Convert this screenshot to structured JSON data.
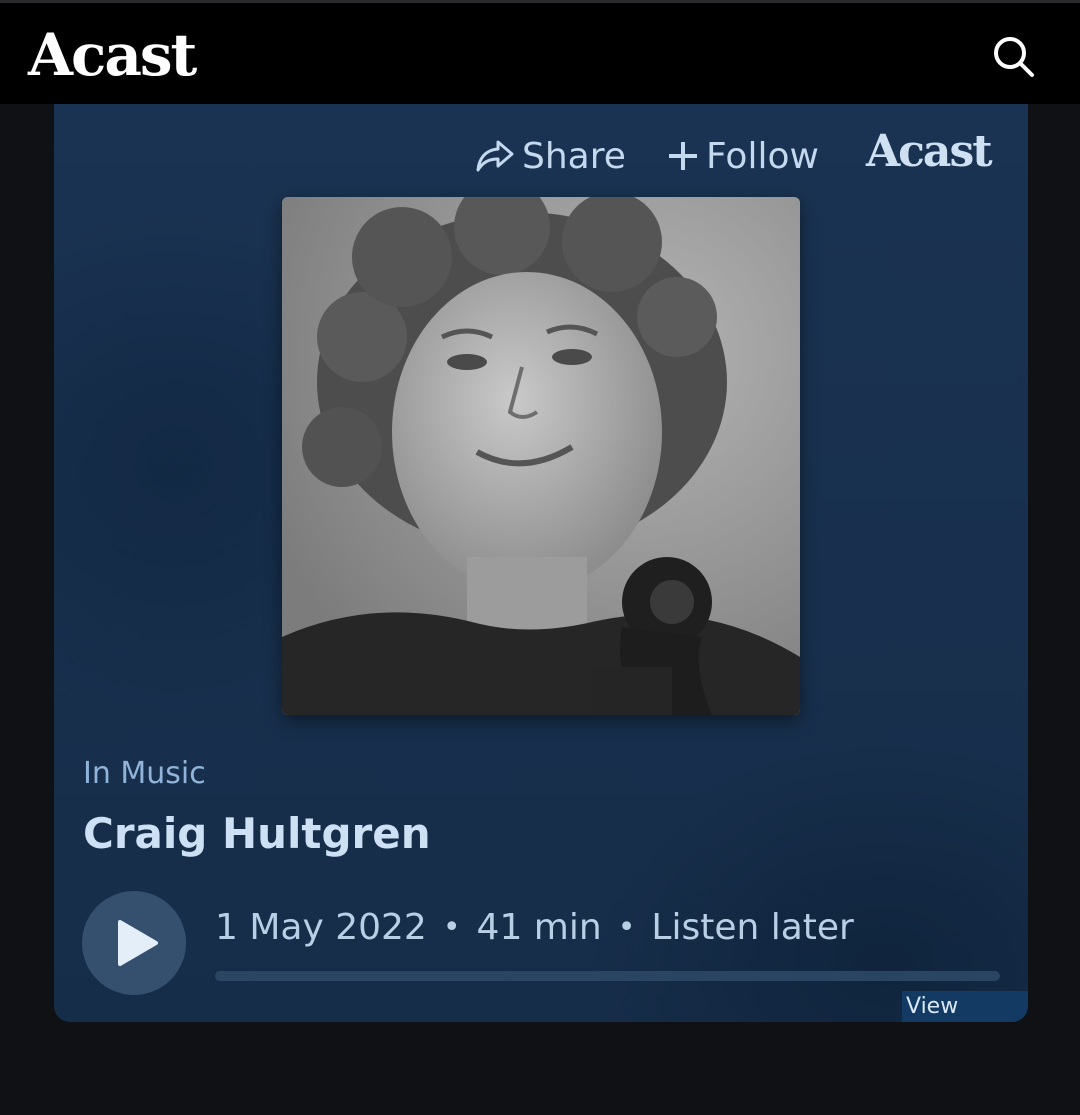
{
  "header": {
    "logo_text": "Acast",
    "search_icon": "search-icon"
  },
  "player": {
    "share_label": "Share",
    "follow_label": "Follow",
    "logo_text": "Acast",
    "cover_image": "portrait-photo",
    "category": "In Music",
    "title": "Craig Hultgren",
    "date": "1 May 2022",
    "separator": "•",
    "duration": "41 min",
    "listen_later_label": "Listen later",
    "progress": 0,
    "view_terms_label": "View terms"
  },
  "colors": {
    "background": "#101114",
    "topbar": "#000000",
    "card": "#1a3352",
    "accent_text": "#c4d8ee",
    "category_text": "#8fb3d9",
    "play_button": "#35506f"
  }
}
